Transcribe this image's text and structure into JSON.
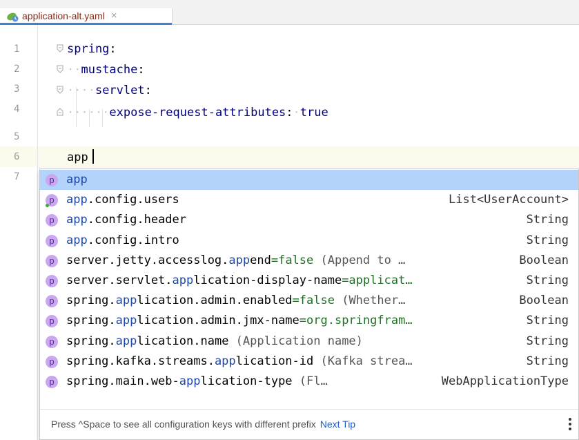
{
  "tab": {
    "label": "application-alt.yaml",
    "close": "×",
    "icon": "spring-leaf-icon"
  },
  "editor": {
    "line_numbers": [
      "1",
      "2",
      "3",
      "4",
      "5",
      "6",
      "7"
    ],
    "lines": [
      {
        "key": "spring",
        "colon": ":"
      },
      {
        "key": "mustache",
        "colon": ":"
      },
      {
        "key": "servlet",
        "colon": ":"
      },
      {
        "key": "expose-request-attributes",
        "colon": ":",
        "value": "true"
      },
      {
        "text": ""
      },
      {
        "text": "app"
      }
    ]
  },
  "completion": {
    "items": [
      {
        "badge": "p",
        "match": "app",
        "rest": "",
        "eq": "",
        "desc": "",
        "type": ""
      },
      {
        "badge": "p",
        "match": "app",
        "rest": ".config.users",
        "eq": "",
        "desc": "",
        "type": "List<UserAccount>"
      },
      {
        "badge": "p",
        "match": "app",
        "rest": ".config.header",
        "eq": "",
        "desc": "",
        "type": "String"
      },
      {
        "badge": "p",
        "match": "app",
        "rest": ".config.intro",
        "eq": "",
        "desc": "",
        "type": "String"
      },
      {
        "badge": "p",
        "pre": "server.jetty.accesslog.",
        "match": "app",
        "rest": "end",
        "eq": "=false",
        "desc": " (Append to …",
        "type": "Boolean"
      },
      {
        "badge": "p",
        "pre": "server.servlet.",
        "match": "app",
        "rest": "lication-display-name",
        "eq": "=applicat…",
        "desc": "",
        "type": "String"
      },
      {
        "badge": "p",
        "pre": "spring.",
        "match": "app",
        "rest": "lication.admin.enabled",
        "eq": "=false",
        "desc": " (Whether…",
        "type": "Boolean"
      },
      {
        "badge": "p",
        "pre": "spring.",
        "match": "app",
        "rest": "lication.admin.jmx-name",
        "eq": "=org.springfram…",
        "desc": "",
        "type": "String"
      },
      {
        "badge": "p",
        "pre": "spring.",
        "match": "app",
        "rest": "lication.name",
        "eq": "",
        "desc": " (Application name)",
        "type": "String"
      },
      {
        "badge": "p",
        "pre": "spring.kafka.streams.",
        "match": "app",
        "rest": "lication-id",
        "eq": "",
        "desc": " (Kafka strea…",
        "type": "String"
      },
      {
        "badge": "p",
        "pre": "spring.main.web-",
        "match": "app",
        "rest": "lication-type",
        "eq": "",
        "desc": " (Fl…",
        "type": "WebApplicationType"
      }
    ],
    "footer": "Press ^Space to see all configuration keys with different prefix",
    "footer_link": "Next Tip",
    "menu_icon": "more-vertical-icon"
  },
  "colors": {
    "accent": "#4083c9",
    "selection": "#b3d3fa",
    "badge": "#c9a8f0"
  }
}
